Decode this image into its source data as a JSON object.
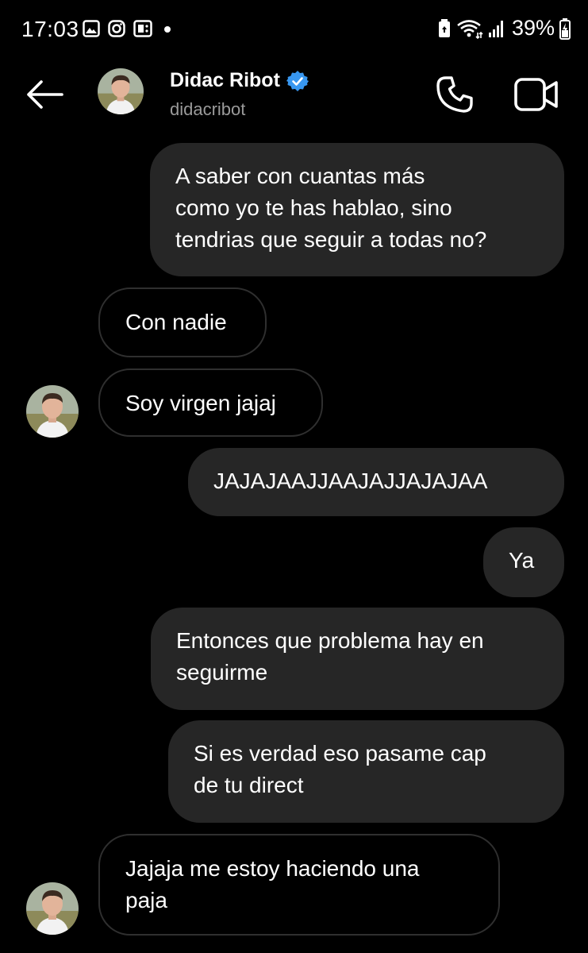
{
  "status_bar": {
    "time": "17:03",
    "left_icons": [
      "gallery-icon",
      "instagram-icon",
      "screen-record-icon",
      "dot-icon"
    ],
    "battery_percent": "39%",
    "right_icons": [
      "battery-saver-icon",
      "wifi-icon",
      "signal-icon",
      "charging-battery-icon"
    ]
  },
  "header": {
    "contact_name": "Didac Ribot",
    "verified": true,
    "username": "didacribot",
    "icons": [
      "back-arrow-icon",
      "phone-icon",
      "video-camera-icon"
    ]
  },
  "messages": [
    {
      "sender": "me",
      "text": "A saber con cuantas más\ncomo yo te has hablao, sino\ntendrias que seguir a todas no?"
    },
    {
      "sender": "them",
      "text": "Con nadie",
      "show_avatar": false
    },
    {
      "sender": "them",
      "text": "Soy virgen jajaj",
      "show_avatar": true
    },
    {
      "sender": "me",
      "text": "JAJAJAAJJAAJAJJAJAJAA"
    },
    {
      "sender": "me",
      "text": "Ya"
    },
    {
      "sender": "me",
      "text": "Entonces que problema hay en\nseguirme"
    },
    {
      "sender": "me",
      "text": "Si es verdad eso pasame cap\nde tu direct"
    },
    {
      "sender": "them",
      "text": "Jajaja me estoy haciendo una\npaja",
      "show_avatar": true
    }
  ],
  "colors": {
    "background": "#000000",
    "sent_bubble": "#262626",
    "received_border": "#2f2f2f",
    "username_gray": "#9a9a9a",
    "verified_blue": "#3897f0"
  }
}
